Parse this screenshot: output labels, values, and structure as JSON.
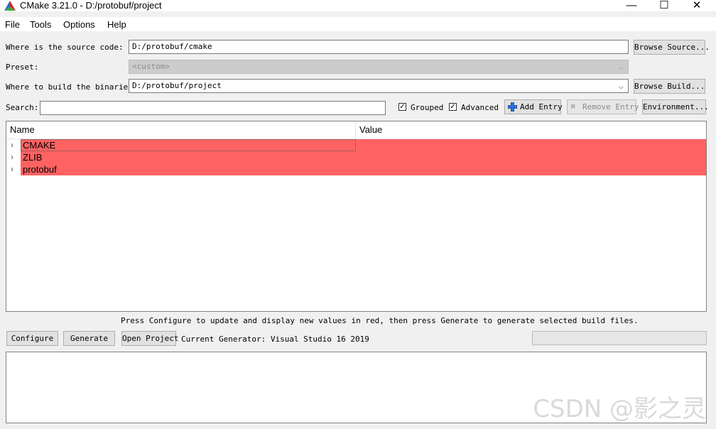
{
  "window": {
    "title": "CMake 3.21.0 - D:/protobuf/project",
    "minimize_glyph": "—",
    "maximize_glyph": "☐",
    "close_glyph": "✕",
    "app_icon": "cmake-logo-icon"
  },
  "menu": [
    {
      "label": "File"
    },
    {
      "label": "Tools"
    },
    {
      "label": "Options"
    },
    {
      "label": "Help"
    }
  ],
  "source": {
    "label": "Where is the source code:",
    "value": "D:/protobuf/cmake",
    "browse_label": "Browse Source..."
  },
  "preset": {
    "label": "Preset:",
    "value": "<custom>"
  },
  "build": {
    "label": "Where to build the binaries:",
    "value": "D:/protobuf/project",
    "browse_label": "Browse Build..."
  },
  "search": {
    "label": "Search:",
    "value": "",
    "grouped_label": "Grouped",
    "grouped_checked": true,
    "advanced_label": "Advanced",
    "advanced_checked": true,
    "add_entry_label": "Add Entry",
    "remove_entry_label": "Remove Entry",
    "environment_label": "Environment..."
  },
  "tree": {
    "columns": [
      "Name",
      "Value"
    ],
    "rows": [
      {
        "name": "CMAKE"
      },
      {
        "name": "ZLIB"
      },
      {
        "name": "protobuf"
      }
    ],
    "row_color": "#ff6262"
  },
  "hint": "Press Configure to update and display new values in red, then press Generate to generate selected build files.",
  "actions": {
    "configure_label": "Configure",
    "generate_label": "Generate",
    "open_project_label": "Open Project",
    "generator_text": "Current Generator: Visual Studio 16 2019"
  },
  "watermark": "CSDN @影之灵"
}
